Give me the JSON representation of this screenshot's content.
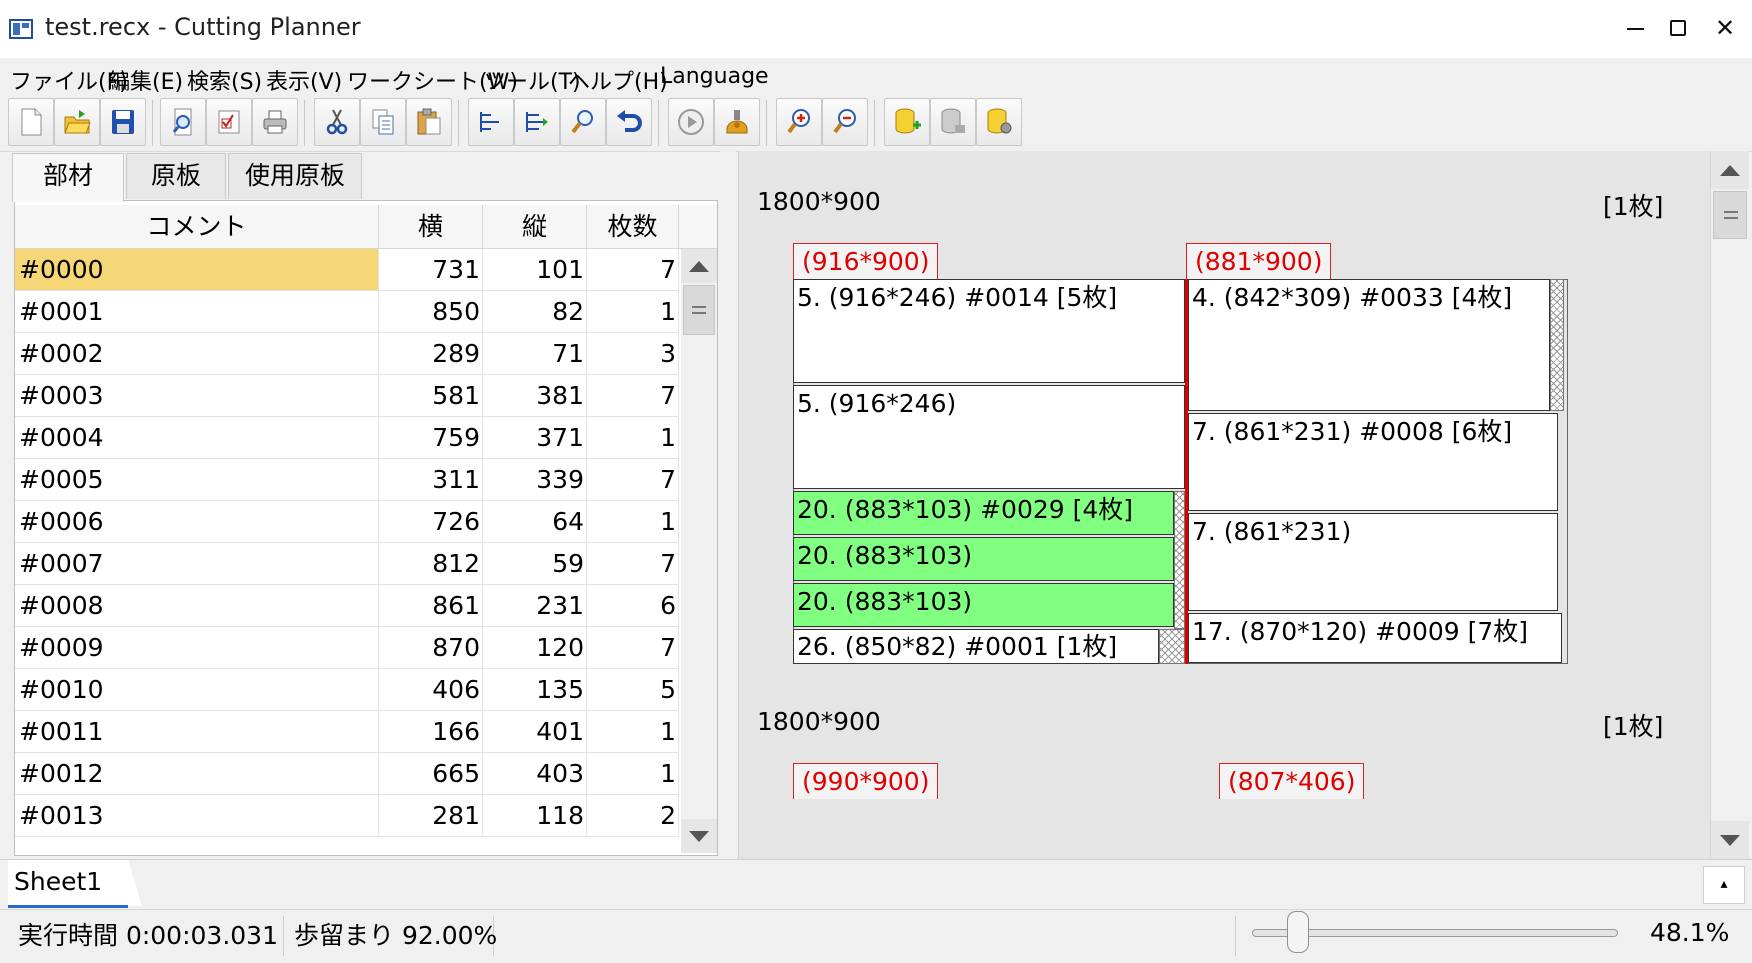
{
  "window": {
    "title": "test.recx - Cutting Planner",
    "app_icon": "table-app-icon",
    "controls": [
      "minimize-icon",
      "maximize-icon",
      "close-icon"
    ]
  },
  "menu": [
    "ファイル(F)",
    "編集(E)",
    "検索(S)",
    "表示(V)",
    "ワークシート(W)",
    "ツール(T)",
    "ヘルプ(H)",
    "Language"
  ],
  "toolbar": {
    "groups": [
      [
        "new-file-icon",
        "open-folder-icon",
        "save-disk-icon"
      ],
      [
        "print-preview-icon",
        "check-list-icon",
        "printer-icon"
      ],
      [
        "cut-scissors-icon",
        "copy-icon",
        "paste-icon"
      ],
      [
        "align-left-icon",
        "align-right-icon",
        "find-magnifier-icon",
        "undo-icon"
      ],
      [
        "run-play-icon",
        "robot-worker-icon"
      ],
      [
        "zoom-in-icon",
        "zoom-out-icon"
      ],
      [
        "database-add-icon",
        "database-gray-icon",
        "database-settings-icon"
      ]
    ]
  },
  "left_tabs": [
    "部材",
    "原板",
    "使用原板"
  ],
  "parts_table": {
    "columns": [
      "コメント",
      "横",
      "縦",
      "枚数"
    ],
    "rows": [
      [
        "#0000",
        "731",
        "101",
        "7"
      ],
      [
        "#0001",
        "850",
        "82",
        "1"
      ],
      [
        "#0002",
        "289",
        "71",
        "3"
      ],
      [
        "#0003",
        "581",
        "381",
        "7"
      ],
      [
        "#0004",
        "759",
        "371",
        "1"
      ],
      [
        "#0005",
        "311",
        "339",
        "7"
      ],
      [
        "#0006",
        "726",
        "64",
        "1"
      ],
      [
        "#0007",
        "812",
        "59",
        "7"
      ],
      [
        "#0008",
        "861",
        "231",
        "6"
      ],
      [
        "#0009",
        "870",
        "120",
        "7"
      ],
      [
        "#0010",
        "406",
        "135",
        "5"
      ],
      [
        "#0011",
        "166",
        "401",
        "1"
      ],
      [
        "#0012",
        "665",
        "403",
        "1"
      ],
      [
        "#0013",
        "281",
        "118",
        "2"
      ]
    ],
    "selected_row": 0
  },
  "layout": {
    "sheet1": {
      "size": "1800*900",
      "count": "[1枚]",
      "strip_left": "(916*900)",
      "strip_right": "(881*900)",
      "pieces_left": [
        {
          "label": "5. (916*246) #0014 [5枚]",
          "green": false
        },
        {
          "label": "5. (916*246)",
          "green": false
        },
        {
          "label": "20. (883*103) #0029 [4枚]",
          "green": true
        },
        {
          "label": "20. (883*103)",
          "green": true
        },
        {
          "label": "20. (883*103)",
          "green": true
        },
        {
          "label": "26. (850*82) #0001 [1枚]",
          "green": false
        }
      ],
      "pieces_right": [
        {
          "label": "4. (842*309) #0033 [4枚]",
          "green": false
        },
        {
          "label": "7. (861*231) #0008 [6枚]",
          "green": false
        },
        {
          "label": "7. (861*231)",
          "green": false
        },
        {
          "label": "17. (870*120) #0009 [7枚]",
          "green": false
        }
      ]
    },
    "sheet2": {
      "size": "1800*900",
      "count": "[1枚]",
      "strip_left": "(990*900)",
      "strip_right": "(807*406)"
    }
  },
  "sheet_tabs": {
    "active": "Sheet1",
    "add_symbol": "▴"
  },
  "status": {
    "exec_time": "実行時間 0:00:03.031",
    "yield": "歩留まり 92.00%",
    "zoom": "48.1%",
    "zoom_level": 0.1245
  },
  "colors": {
    "selected_row": "#f5d777",
    "green_piece": "#80ff80",
    "cut_red": "#e00000"
  }
}
